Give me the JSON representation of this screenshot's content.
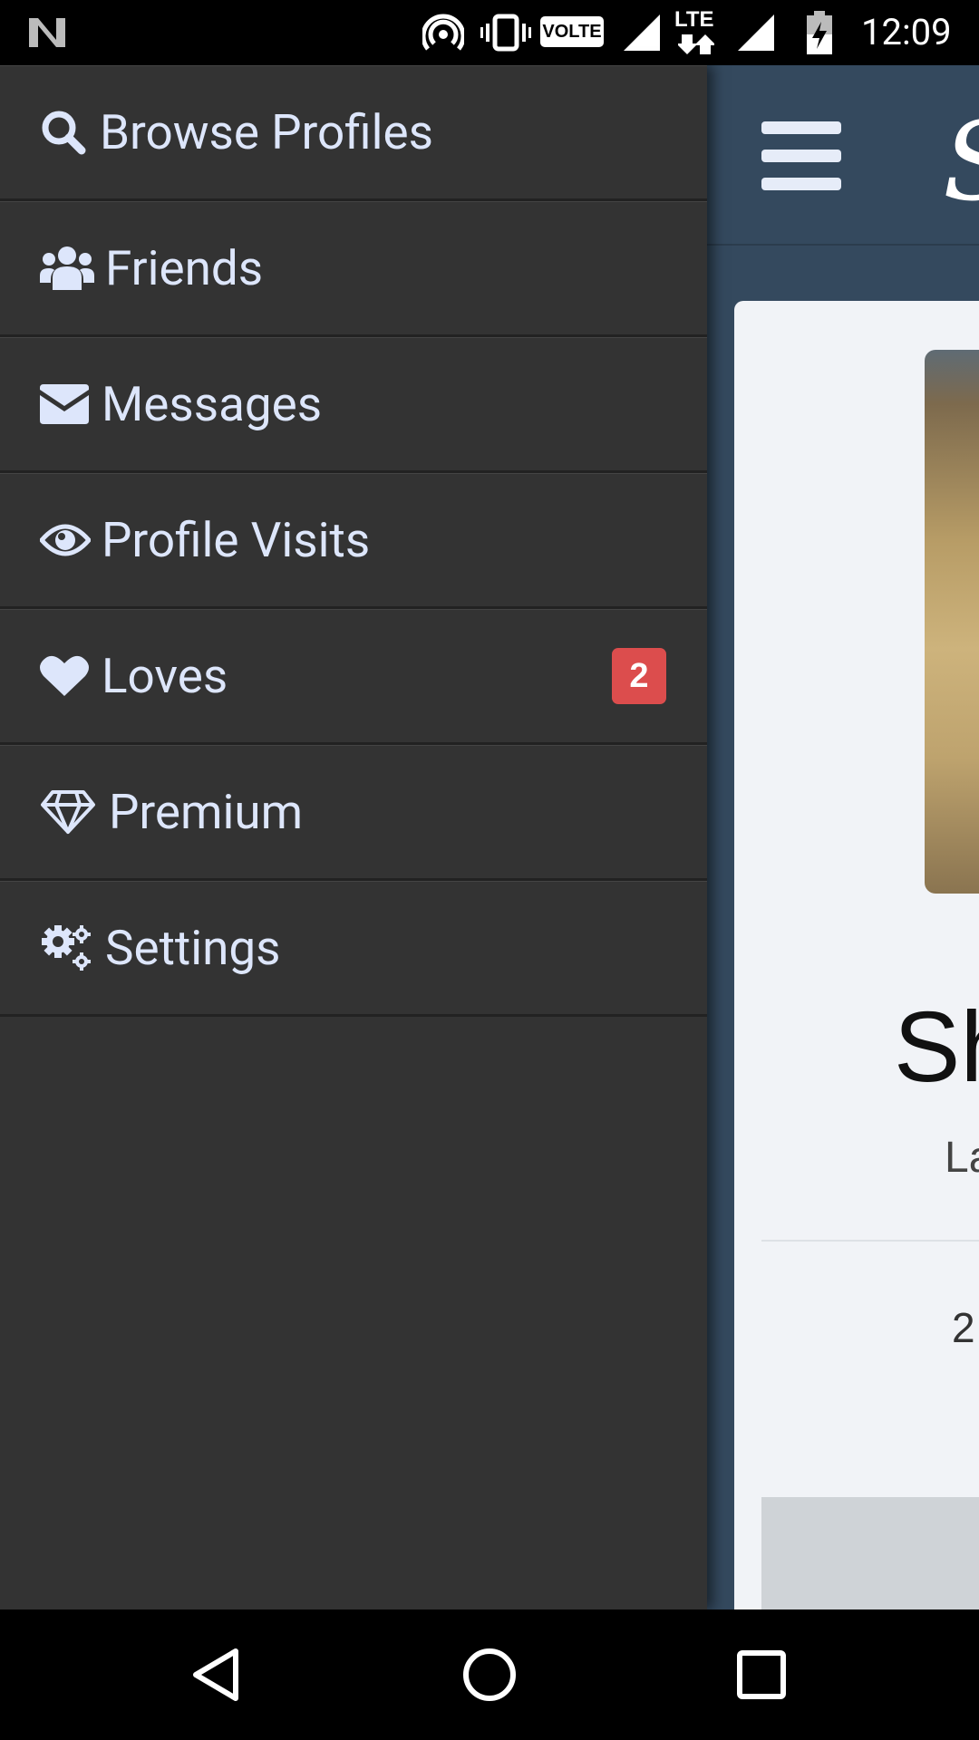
{
  "status_bar": {
    "time": "12:09",
    "network_label": "LTE",
    "volte_label": "VOLTE",
    "icons": [
      "notification-n-icon",
      "hotspot-icon",
      "vibrate-icon",
      "volte-icon",
      "signal-icon",
      "lte-icon",
      "signal-icon",
      "battery-charging-icon"
    ]
  },
  "drawer": {
    "items": [
      {
        "label": "Browse Profiles",
        "icon": "search-icon"
      },
      {
        "label": "Friends",
        "icon": "users-icon"
      },
      {
        "label": "Messages",
        "icon": "envelope-icon"
      },
      {
        "label": "Profile Visits",
        "icon": "eye-icon"
      },
      {
        "label": "Loves",
        "icon": "heart-icon",
        "badge": "2"
      },
      {
        "label": "Premium",
        "icon": "diamond-icon"
      },
      {
        "label": "Settings",
        "icon": "cogs-icon"
      }
    ]
  },
  "background": {
    "logo_letter": "S",
    "profile_name_partial": "Sh",
    "profile_sub_partial": "La",
    "stat_partial": "2"
  },
  "colors": {
    "drawer_bg": "#333333",
    "drawer_text": "#dde6fb",
    "badge": "#dc4d4d",
    "header_bg": "#34495e"
  },
  "nav_bar": {
    "buttons": [
      "back-icon",
      "home-icon",
      "recents-icon"
    ]
  }
}
